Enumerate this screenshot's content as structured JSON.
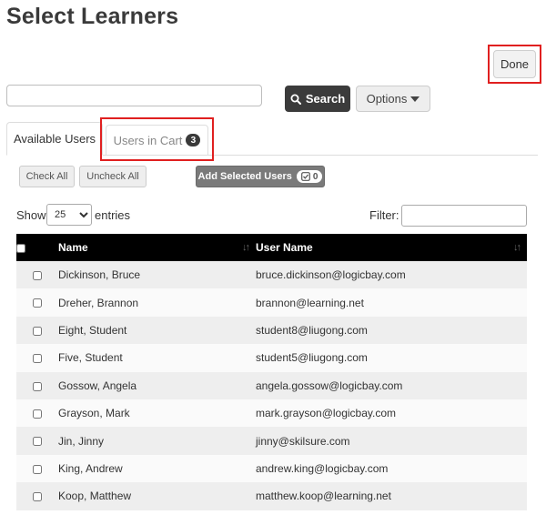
{
  "page": {
    "title": "Select Learners"
  },
  "header": {
    "done_label": "Done"
  },
  "search": {
    "value": "",
    "button_label": "Search",
    "options_label": "Options"
  },
  "tabs": {
    "available_label": "Available Users",
    "cart_label": "Users in Cart",
    "cart_count": "3"
  },
  "actions": {
    "check_all": "Check All",
    "uncheck_all": "Uncheck All",
    "add_selected": "Add Selected Users",
    "selected_count": "0"
  },
  "list_controls": {
    "show_label": "Show",
    "page_size": "25",
    "entries_label": "entries",
    "filter_label": "Filter:",
    "filter_value": ""
  },
  "table": {
    "columns": [
      "Name",
      "User Name"
    ],
    "rows": [
      {
        "name": "Dickinson, Bruce",
        "username": "bruce.dickinson@logicbay.com"
      },
      {
        "name": "Dreher, Brannon",
        "username": "brannon@learning.net"
      },
      {
        "name": "Eight, Student",
        "username": "student8@liugong.com"
      },
      {
        "name": "Five, Student",
        "username": "student5@liugong.com"
      },
      {
        "name": "Gossow, Angela",
        "username": "angela.gossow@logicbay.com"
      },
      {
        "name": "Grayson, Mark",
        "username": "mark.grayson@logicbay.com"
      },
      {
        "name": "Jin, Jinny",
        "username": "jinny@skilsure.com"
      },
      {
        "name": "King, Andrew",
        "username": "andrew.king@logicbay.com"
      },
      {
        "name": "Koop, Matthew",
        "username": "matthew.koop@learning.net"
      }
    ]
  },
  "colors": {
    "highlight": "#e02020",
    "header_bg": "#000000",
    "search_btn": "#3b3b3b"
  }
}
